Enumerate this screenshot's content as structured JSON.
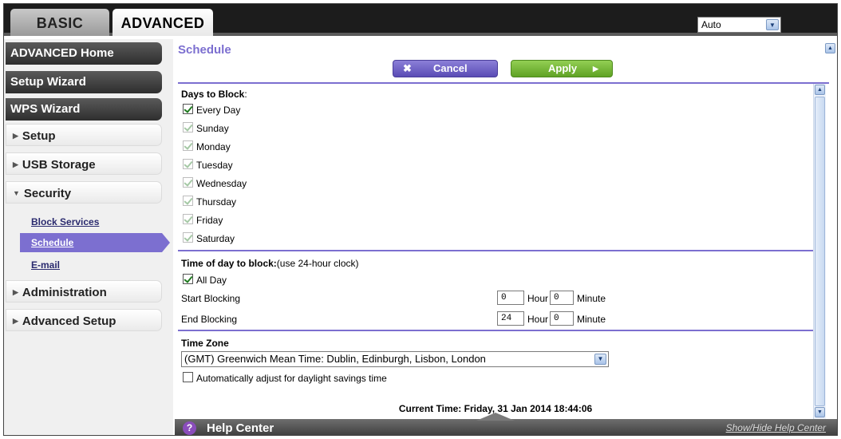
{
  "tabs": {
    "basic": "BASIC",
    "advanced": "ADVANCED"
  },
  "language": {
    "selected": "Auto"
  },
  "sidebar": {
    "dark_items": [
      "ADVANCED Home",
      "Setup Wizard",
      "WPS Wizard"
    ],
    "sections": [
      "Setup",
      "USB Storage",
      "Security",
      "Administration",
      "Advanced Setup"
    ],
    "security_sub": [
      "Block Services",
      "Schedule",
      "E-mail"
    ]
  },
  "page": {
    "title": "Schedule",
    "cancel_label": "Cancel",
    "apply_label": "Apply",
    "days_label": "Days to Block",
    "days_colon": ":",
    "every_day": "Every Day",
    "days": [
      "Sunday",
      "Monday",
      "Tuesday",
      "Wednesday",
      "Thursday",
      "Friday",
      "Saturday"
    ],
    "time_label": "Time of day to block:",
    "time_note": "(use 24-hour clock)",
    "all_day": "All Day",
    "start_label": "Start Blocking",
    "end_label": "End Blocking",
    "start_hour": "0",
    "start_minute": "0",
    "end_hour": "24",
    "end_minute": "0",
    "hour_unit": "Hour",
    "minute_unit": "Minute",
    "timezone_label": "Time Zone",
    "timezone_value": "(GMT) Greenwich Mean Time: Dublin, Edinburgh, Lisbon, London",
    "dst_label": "Automatically adjust for daylight savings time",
    "current_time": "Current Time: Friday, 31 Jan 2014 18:44:06"
  },
  "help": {
    "title": "Help Center",
    "toggle": "Show/Hide Help Center",
    "icon": "question-icon"
  }
}
